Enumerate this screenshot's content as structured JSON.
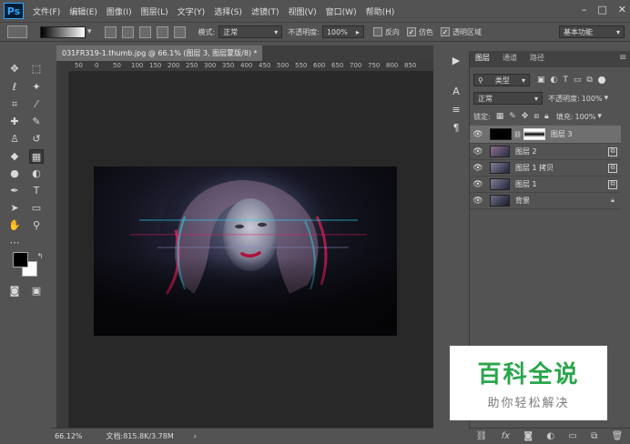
{
  "app": {
    "logo": "Ps"
  },
  "menu": [
    "文件(F)",
    "编辑(E)",
    "图像(I)",
    "图层(L)",
    "文字(Y)",
    "选择(S)",
    "滤镜(T)",
    "视图(V)",
    "窗口(W)",
    "帮助(H)"
  ],
  "window_controls": [
    "–",
    "□",
    "✕"
  ],
  "options": {
    "mode_label": "模式:",
    "mode_value": "正常",
    "opacity_label": "不透明度:",
    "opacity_value": "100%",
    "reverse_label": "反向",
    "dither_label": "仿色",
    "transparency_label": "透明区域",
    "workspace": "基本功能"
  },
  "document": {
    "tab_title": "031FR319-1.thumb.jpg @ 66.1% (图层 3, 图层蒙版/8) *",
    "ruler_marks": [
      "50",
      "0",
      "50",
      "100",
      "150",
      "200",
      "250",
      "300",
      "350",
      "400",
      "450",
      "500",
      "550",
      "600",
      "650",
      "700",
      "750",
      "800",
      "850"
    ]
  },
  "status": {
    "zoom": "66.12%",
    "doc_info": "文档:815.8K/3.78M"
  },
  "layers_panel": {
    "tabs": [
      "图层",
      "通道",
      "路径"
    ],
    "filter_label": "类型",
    "blend_mode": "正常",
    "opacity_label": "不透明度:",
    "opacity_value": "100%",
    "lock_label": "锁定:",
    "fill_label": "填充:",
    "fill_value": "100%",
    "layers": [
      {
        "name": "图层 3",
        "selected": true
      },
      {
        "name": "图层 2",
        "selected": false
      },
      {
        "name": "图层 1 拷贝",
        "selected": false
      },
      {
        "name": "图层 1",
        "selected": false
      },
      {
        "name": "背景",
        "selected": false
      }
    ],
    "footer_icons": [
      "link-icon",
      "fx-icon",
      "mask-icon",
      "adjustment-icon",
      "folder-icon",
      "new-layer-icon",
      "trash-icon"
    ]
  },
  "watermark": {
    "title": "百科全说",
    "subtitle": "助你轻松解决"
  },
  "colors": {
    "accent": "#31a8ff",
    "watermark_green": "#2aa54b",
    "panel_bg": "#535353"
  }
}
